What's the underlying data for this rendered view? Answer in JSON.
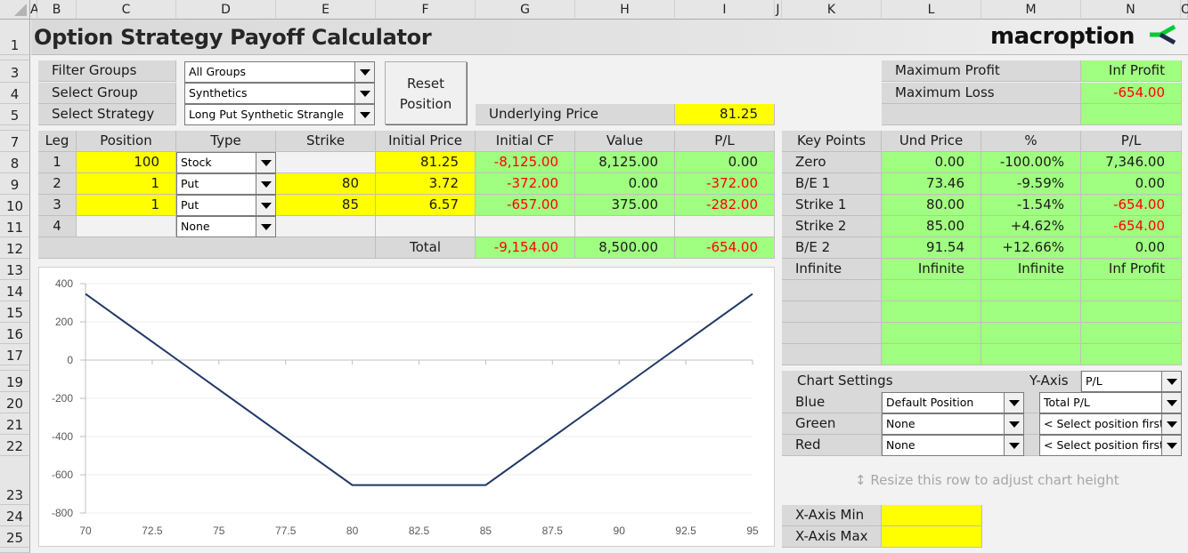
{
  "columns": [
    "A",
    "B",
    "C",
    "D",
    "E",
    "F",
    "G",
    "H",
    "I",
    "J",
    "K",
    "L",
    "M",
    "N",
    "O"
  ],
  "rows": [
    "1",
    "3",
    "4",
    "5",
    "7",
    "8",
    "9",
    "10",
    "11",
    "12",
    "13",
    "14",
    "15",
    "16",
    "17",
    "19",
    "20",
    "21",
    "22",
    "23",
    "24",
    "25"
  ],
  "title": "Option Strategy Payoff Calculator",
  "logo": {
    "text": "macroption",
    "mark_colors": {
      "green": "#00cc33",
      "navy": "#1f2a4d"
    }
  },
  "selectors": {
    "filter_groups": {
      "label": "Filter Groups",
      "value": "All Groups"
    },
    "select_group": {
      "label": "Select Group",
      "value": "Synthetics"
    },
    "select_strategy": {
      "label": "Select Strategy",
      "value": "Long Put Synthetic Strangle"
    }
  },
  "reset_button": {
    "line1": "Reset",
    "line2": "Position"
  },
  "underlying": {
    "label": "Underlying Price",
    "value": "81.25"
  },
  "summary": {
    "max_profit_label": "Maximum Profit",
    "max_profit": "Inf Profit",
    "max_loss_label": "Maximum Loss",
    "max_loss": "-654.00"
  },
  "legs_table": {
    "headers": [
      "Leg",
      "Position",
      "Type",
      "Strike",
      "Initial Price",
      "Initial CF",
      "Value",
      "P/L"
    ],
    "rows": [
      {
        "leg": "1",
        "position": "100",
        "type": "Stock",
        "strike": "",
        "initial_price": "81.25",
        "initial_cf": "-8,125.00",
        "value": "8,125.00",
        "pl": "0.00"
      },
      {
        "leg": "2",
        "position": "1",
        "type": "Put",
        "strike": "80",
        "initial_price": "3.72",
        "initial_cf": "-372.00",
        "value": "0.00",
        "pl": "-372.00"
      },
      {
        "leg": "3",
        "position": "1",
        "type": "Put",
        "strike": "85",
        "initial_price": "6.57",
        "initial_cf": "-657.00",
        "value": "375.00",
        "pl": "-282.00"
      },
      {
        "leg": "4",
        "position": "",
        "type": "None",
        "strike": "",
        "initial_price": "",
        "initial_cf": "",
        "value": "",
        "pl": ""
      }
    ],
    "total": {
      "label": "Total",
      "initial_cf": "-9,154.00",
      "value": "8,500.00",
      "pl": "-654.00"
    }
  },
  "key_points": {
    "headers": [
      "Key Points",
      "Und Price",
      "%",
      "P/L"
    ],
    "rows": [
      {
        "name": "Zero",
        "und_price": "0.00",
        "pct": "-100.00%",
        "pl": "7,346.00"
      },
      {
        "name": "B/E 1",
        "und_price": "73.46",
        "pct": "-9.59%",
        "pl": "0.00"
      },
      {
        "name": "Strike 1",
        "und_price": "80.00",
        "pct": "-1.54%",
        "pl": "-654.00"
      },
      {
        "name": "Strike 2",
        "und_price": "85.00",
        "pct": "+4.62%",
        "pl": "-654.00"
      },
      {
        "name": "B/E 2",
        "und_price": "91.54",
        "pct": "+12.66%",
        "pl": "0.00"
      },
      {
        "name": "Infinite",
        "und_price": "Infinite",
        "pct": "Infinite",
        "pl": "Inf Profit"
      }
    ]
  },
  "chart_settings": {
    "title": "Chart Settings",
    "y_axis_label": "Y-Axis",
    "y_axis_value": "P/L",
    "rows": [
      {
        "label": "Blue",
        "position": "Default Position",
        "series": "Total P/L"
      },
      {
        "label": "Green",
        "position": "None",
        "series": "< Select position first"
      },
      {
        "label": "Red",
        "position": "None",
        "series": "< Select position first"
      }
    ]
  },
  "resize_hint": "Resize this row to adjust chart height",
  "x_axis": {
    "min_label": "X-Axis Min",
    "min_value": "",
    "max_label": "X-Axis Max",
    "max_value": ""
  },
  "colors": {
    "positive": "#000000",
    "negative": "#ff0000",
    "input": "#ffff00",
    "output": "#a0ff80",
    "line": "#1f3864"
  },
  "chart_data": {
    "type": "line",
    "title": "",
    "xlabel": "",
    "ylabel": "",
    "xlim": [
      70,
      95
    ],
    "ylim": [
      -800,
      400
    ],
    "xticks": [
      70,
      72.5,
      75,
      77.5,
      80,
      82.5,
      85,
      87.5,
      90,
      92.5,
      95
    ],
    "xtick_labels": [
      "70",
      "72.5",
      "75",
      "77.5",
      "80",
      "82.5",
      "85",
      "87.5",
      "90",
      "92.5",
      "95"
    ],
    "yticks": [
      -800,
      -600,
      -400,
      -200,
      0,
      200,
      400
    ],
    "ytick_labels": [
      "-800",
      "-600",
      "-400",
      "-200",
      "0",
      "200",
      "400"
    ],
    "grid": "horizontal",
    "series": [
      {
        "name": "Total P/L",
        "color": "#1f3864",
        "x": [
          70,
          73.46,
          80,
          85,
          91.54,
          95
        ],
        "y": [
          346,
          0,
          -654,
          -654,
          0,
          346
        ]
      }
    ]
  }
}
